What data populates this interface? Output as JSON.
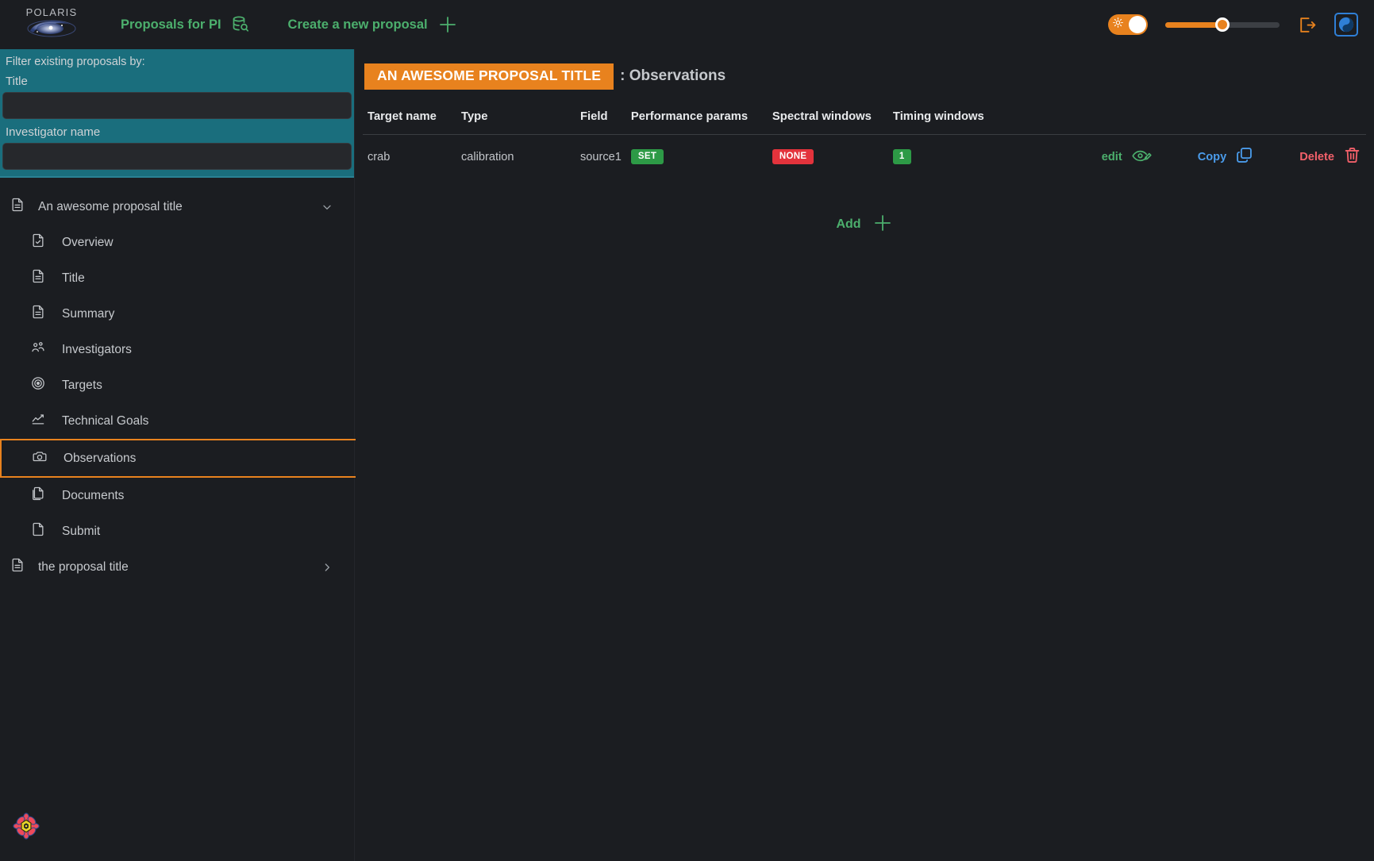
{
  "app": {
    "brand": "POLARIS",
    "brand_icon": "galaxy-icon"
  },
  "topnav": {
    "links": [
      {
        "label": "Proposals for PI",
        "icon": "database-search-icon"
      },
      {
        "label": "Create a new proposal",
        "icon": "plus-icon"
      }
    ],
    "theme_toggle": {
      "icon": "sun-icon",
      "state": "on"
    },
    "brightness_slider": {
      "value": 50
    },
    "logout": {
      "icon": "logout-icon"
    },
    "theme_switch": {
      "icon": "yin-yang-icon"
    }
  },
  "sidebar": {
    "filter": {
      "heading": "Filter existing proposals by:",
      "title_label": "Title",
      "title_value": "",
      "title_placeholder": "",
      "investigator_label": "Investigator name",
      "investigator_value": "",
      "investigator_placeholder": ""
    },
    "tree": [
      {
        "label": "An awesome proposal title",
        "icon": "document-lines-icon",
        "chevron": "chevron-down-icon",
        "expanded": true,
        "children": [
          {
            "label": "Overview",
            "icon": "document-check-icon",
            "selected": false
          },
          {
            "label": "Title",
            "icon": "document-lines-icon",
            "selected": false
          },
          {
            "label": "Summary",
            "icon": "document-lines-icon",
            "selected": false
          },
          {
            "label": "Investigators",
            "icon": "people-icon",
            "selected": false
          },
          {
            "label": "Targets",
            "icon": "target-icon",
            "selected": false
          },
          {
            "label": "Technical Goals",
            "icon": "chart-line-icon",
            "selected": false
          },
          {
            "label": "Observations",
            "icon": "camera-icon",
            "selected": true
          },
          {
            "label": "Documents",
            "icon": "copy-files-icon",
            "selected": false
          },
          {
            "label": "Submit",
            "icon": "document-blank-icon",
            "selected": false
          }
        ]
      },
      {
        "label": "the proposal title",
        "icon": "document-lines-icon",
        "chevron": "chevron-right-icon",
        "expanded": false,
        "children": []
      }
    ],
    "footer_logo": "flower-logo-icon"
  },
  "main": {
    "title_badge": "AN AWESOME PROPOSAL TITLE",
    "title_rest": ": Observations",
    "table": {
      "columns": [
        "Target name",
        "Type",
        "Field",
        "Performance params",
        "Spectral windows",
        "Timing windows"
      ],
      "rows": [
        {
          "target_name": "crab",
          "type": "calibration",
          "field": "source1",
          "performance_params": {
            "text": "SET",
            "style": "green"
          },
          "spectral_windows": {
            "text": "NONE",
            "style": "red"
          },
          "timing_windows": {
            "text": "1",
            "style": "count"
          },
          "actions": [
            {
              "label": "edit",
              "icon": "eye-edit-icon",
              "style": "edit"
            },
            {
              "label": "Copy",
              "icon": "copy-icon",
              "style": "copy"
            },
            {
              "label": "Delete",
              "icon": "trash-icon",
              "style": "delete"
            }
          ]
        }
      ]
    },
    "add": {
      "label": "Add",
      "icon": "plus-icon"
    }
  },
  "colors": {
    "accent_orange": "#e8821e",
    "accent_green": "#4caf6d",
    "accent_blue": "#4a9bea",
    "accent_red": "#f2606a",
    "filter_teal": "#1a6e7d",
    "background": "#1b1d21"
  }
}
